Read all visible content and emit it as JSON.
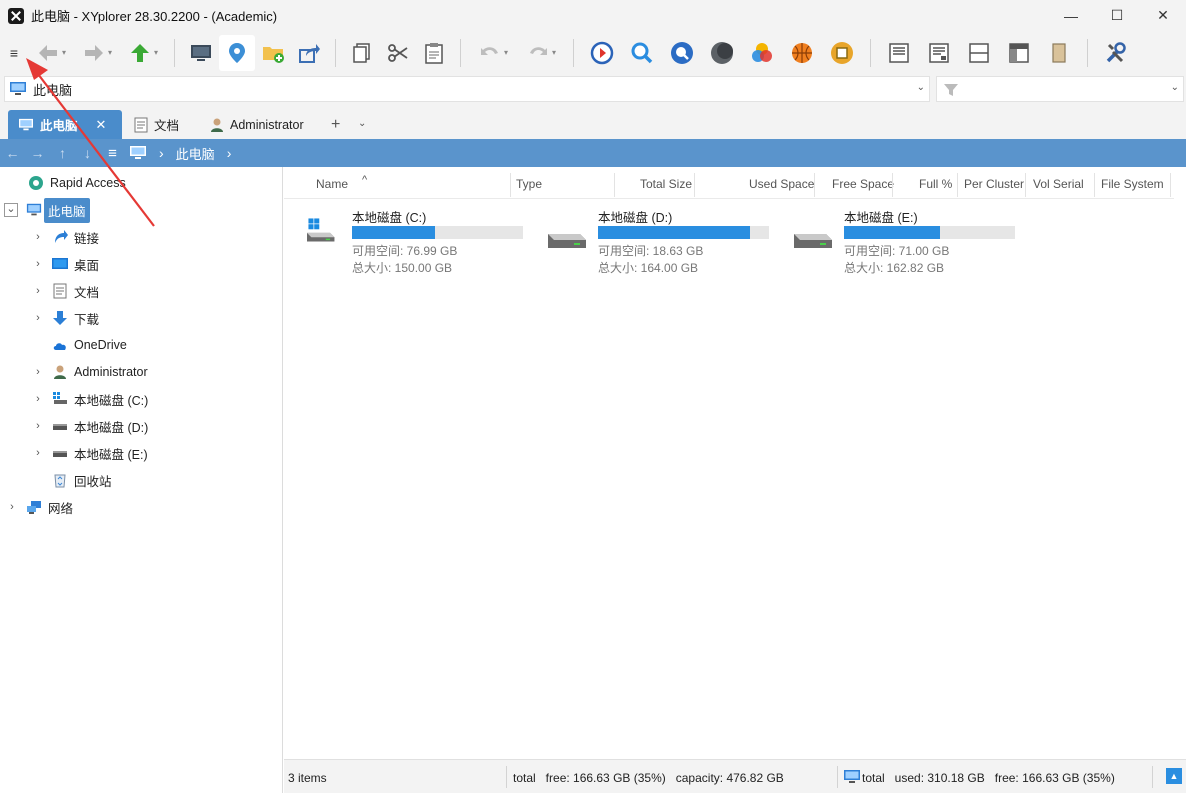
{
  "window": {
    "title": "此电脑 - XYplorer 28.30.2200 - (Academic)",
    "minimize": "—",
    "maximize": "☐",
    "close": "✕"
  },
  "toolbar": {
    "menu_label": "≡"
  },
  "address": {
    "path": "此电脑",
    "filter_placeholder": ""
  },
  "tabs": [
    {
      "label": "此电脑",
      "active": true,
      "close": "✕"
    },
    {
      "label": "文档",
      "active": false
    },
    {
      "label": "Administrator",
      "active": false
    }
  ],
  "tab_add": "+",
  "tab_menu": "⌄",
  "breadcrumb": {
    "back": "←",
    "forward": "→",
    "up": "↑",
    "down": "↓",
    "menu": "≡",
    "sep1": "›",
    "location": "此电脑",
    "sep2": "›"
  },
  "tree": {
    "rapid_access": "Rapid Access",
    "this_pc": "此电脑",
    "items": [
      {
        "label": "链接"
      },
      {
        "label": "桌面"
      },
      {
        "label": "文档"
      },
      {
        "label": "下载"
      },
      {
        "label": "OneDrive"
      },
      {
        "label": "Administrator"
      },
      {
        "label": "本地磁盘 (C:)"
      },
      {
        "label": "本地磁盘 (D:)"
      },
      {
        "label": "本地磁盘 (E:)"
      },
      {
        "label": "回收站"
      }
    ],
    "network": "网络"
  },
  "columns": {
    "name": "Name",
    "sort_indicator": "^",
    "type": "Type",
    "total_size": "Total Size",
    "used_space": "Used Space",
    "free_space": "Free Space",
    "full_pct": "Full %",
    "per_cluster": "Per Cluster",
    "vol_serial": "Vol Serial",
    "file_system": "File System"
  },
  "drives": [
    {
      "name": "本地磁盘 (C:)",
      "free": "可用空间: 76.99 GB",
      "total": "总大小: 150.00 GB",
      "used_fraction": 0.487
    },
    {
      "name": "本地磁盘 (D:)",
      "free": "可用空间: 18.63 GB",
      "total": "总大小: 164.00 GB",
      "used_fraction": 0.886
    },
    {
      "name": "本地磁盘 (E:)",
      "free": "可用空间: 71.00 GB",
      "total": "总大小: 162.82 GB",
      "used_fraction": 0.564
    }
  ],
  "status": {
    "items": "3 items",
    "selection": "total   free: 166.63 GB (35%)   capacity: 476.82 GB",
    "drive_summary": "total   used: 310.18 GB   free: 166.63 GB (35%)",
    "scroll_up": "▲"
  },
  "colors": {
    "accent": "#4a8ccb",
    "breadcrumb_bg": "#5a94cc",
    "drive_bar": "#2a8ee0"
  }
}
